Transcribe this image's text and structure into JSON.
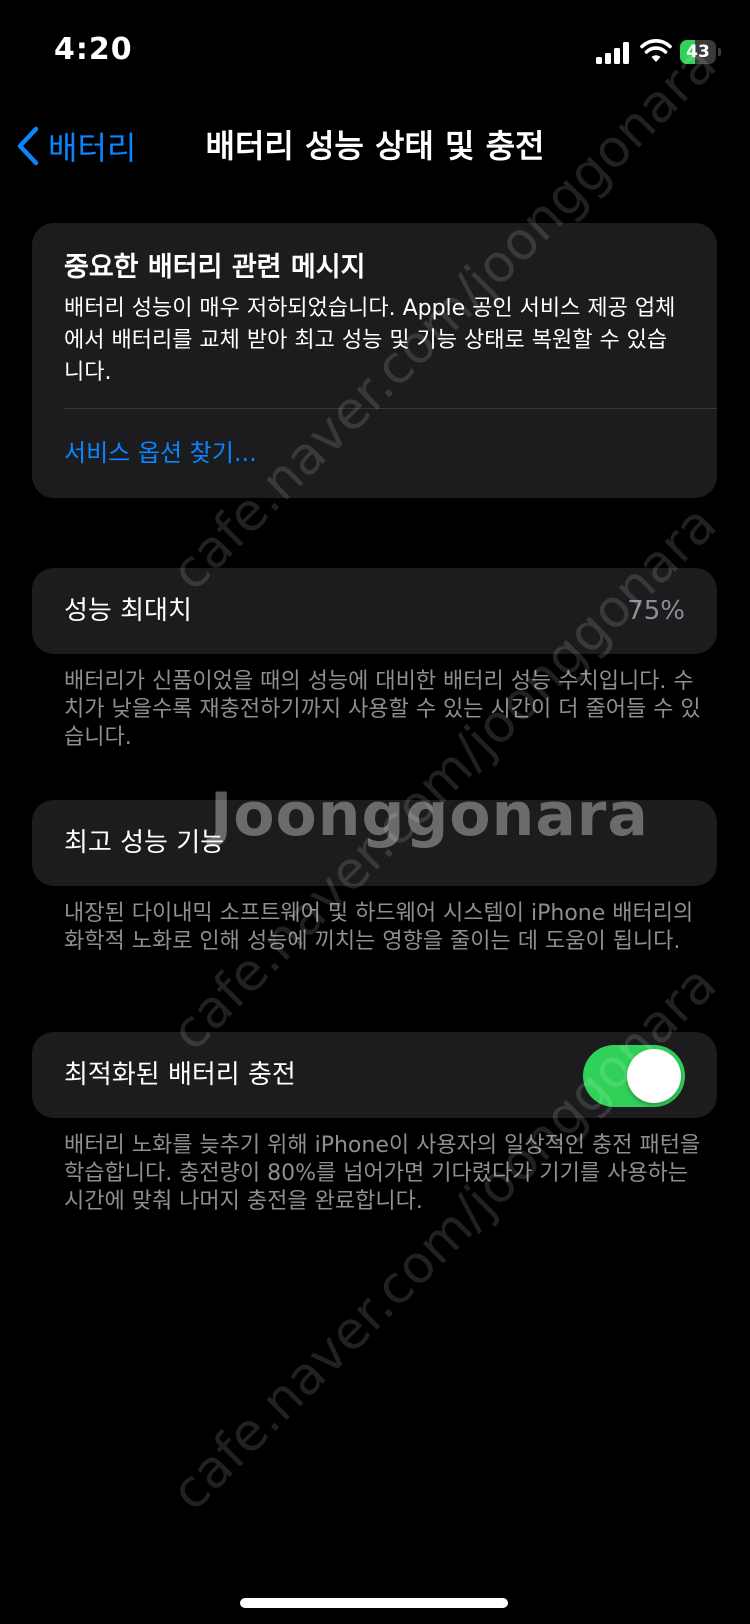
{
  "status_bar": {
    "time": "4:20",
    "battery_level": "43",
    "battery_percent": 43,
    "icons": [
      "cellular-signal-icon",
      "wifi-icon",
      "battery-charging-icon"
    ]
  },
  "nav": {
    "back_label": "배터리",
    "title": "배터리 성능 상태 및 충전"
  },
  "message_card": {
    "title": "중요한 배터리 관련 메시지",
    "body": "배터리 성능이 매우 저하되었습니다. Apple 공인 서비스 제공 업체에서 배터리를 교체 받아 최고 성능 및 기능 상태로 복원할 수 있습니다.",
    "link": "서비스 옵션 찾기..."
  },
  "max_capacity": {
    "label": "성능 최대치",
    "value": "75%",
    "footer": "배터리가 신품이었을 때의 성능에 대비한 배터리 성능 수치입니다. 수치가 낮을수록 재충전하기까지 사용할 수 있는 시간이 더 줄어들 수 있습니다."
  },
  "peak_performance": {
    "label": "최고 성능 기능",
    "footer": "내장된 다이내믹 소프트웨어 및 하드웨어 시스템이 iPhone 배터리의 화학적 노화로 인해 성능에 끼치는 영향을 줄이는 데 도움이 됩니다."
  },
  "optimized_charging": {
    "label": "최적화된 배터리 충전",
    "enabled": true,
    "footer": "배터리 노화를 늦추기 위해 iPhone이 사용자의 일상적인 충전 패턴을 학습합니다. 충전량이 80%를 넘어가면 기다렸다가 기기를 사용하는 시간에 맞춰 나머지 충전을 완료합니다."
  },
  "watermark": {
    "url": "cafe.naver.com/joonggonara",
    "brand": "Joonggonara"
  },
  "colors": {
    "accent": "#0a84ff",
    "toggle_on": "#30d158",
    "card": "#1c1c1e",
    "secondary_text": "#8e8e93"
  }
}
